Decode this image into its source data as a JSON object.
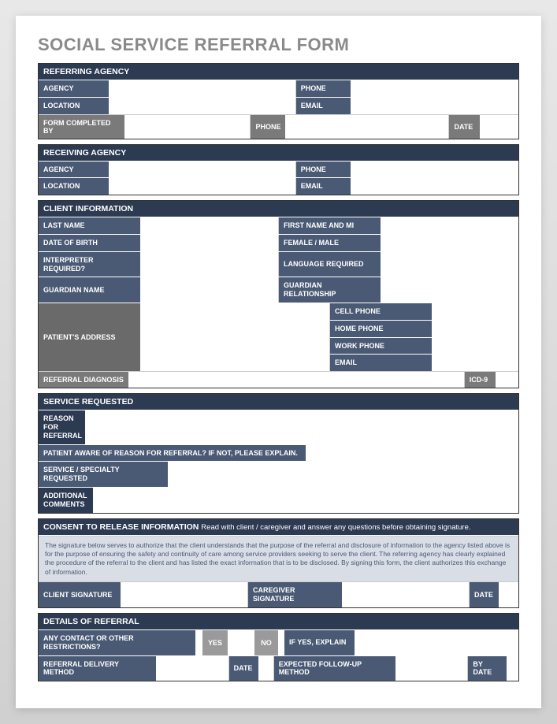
{
  "title": "SOCIAL SERVICE REFERRAL FORM",
  "referring": {
    "header": "REFERRING AGENCY",
    "agency": "AGENCY",
    "phone": "PHONE",
    "location": "LOCATION",
    "email": "EMAIL",
    "completed_by": "FORM COMPLETED BY",
    "cb_phone": "PHONE",
    "cb_date": "DATE"
  },
  "receiving": {
    "header": "RECEIVING AGENCY",
    "agency": "AGENCY",
    "phone": "PHONE",
    "location": "LOCATION",
    "email": "EMAIL"
  },
  "client": {
    "header": "CLIENT INFORMATION",
    "last": "LAST NAME",
    "first": "FIRST NAME AND MI",
    "dob": "DATE OF BIRTH",
    "sex": "FEMALE / MALE",
    "interp": "INTERPRETER REQUIRED?",
    "lang": "LANGUAGE REQUIRED",
    "guardian": "GUARDIAN NAME",
    "grel": "GUARDIAN RELATIONSHIP",
    "address": "PATIENT'S ADDRESS",
    "cell": "CELL PHONE",
    "home": "HOME PHONE",
    "work": "WORK PHONE",
    "email": "EMAIL",
    "diag": "REFERRAL DIAGNOSIS",
    "icd": "ICD-9"
  },
  "service": {
    "header": "SERVICE REQUESTED",
    "reason": "REASON FOR REFERRAL",
    "aware": "PATIENT AWARE OF REASON FOR REFERRAL? IF NOT, PLEASE EXPLAIN.",
    "spec": "SERVICE / SPECIALTY REQUESTED",
    "comments": "ADDITIONAL COMMENTS"
  },
  "consent": {
    "header": "CONSENT TO RELEASE INFORMATION",
    "header_sub": "Read with client / caregiver and answer any questions before obtaining signature.",
    "body": "The signature below serves to authorize that the client understands that the purpose of the referral and disclosure of information to the agency listed above is for the purpose of ensuring the safety and continuity of care among service providers seeking to serve the client. The referring agency has clearly explained the procedure of the referral to the client and has listed the exact information that is to be disclosed.  By signing this form, the client authorizes this exchange of information.",
    "client_sig": "CLIENT SIGNATURE",
    "care_sig": "CAREGIVER SIGNATURE",
    "date": "DATE"
  },
  "details": {
    "header": "DETAILS OF REFERRAL",
    "restrict": "ANY CONTACT OR OTHER RESTRICTIONS?",
    "yes": "YES",
    "no": "NO",
    "explain": "IF YES, EXPLAIN",
    "delivery": "REFERRAL DELIVERY METHOD",
    "date": "DATE",
    "followup": "EXPECTED FOLLOW-UP METHOD",
    "bydate": "BY DATE"
  }
}
